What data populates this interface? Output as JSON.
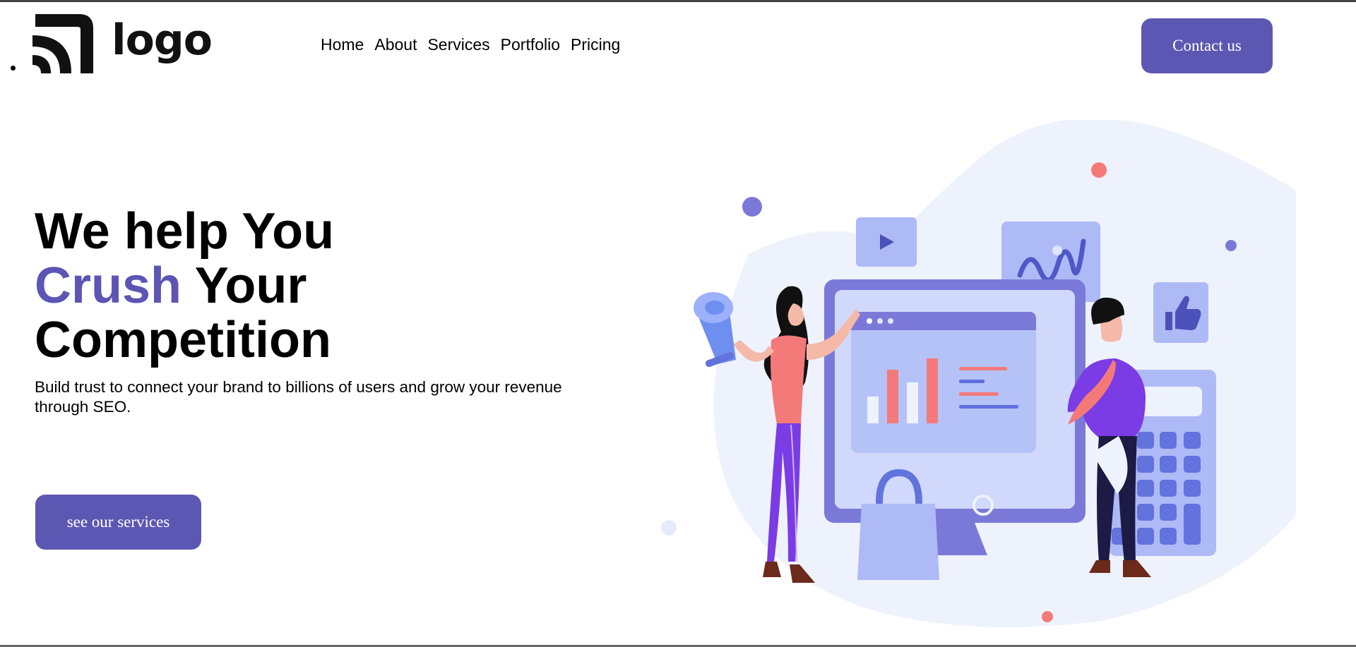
{
  "header": {
    "logo_text": "logo",
    "nav": [
      "Home",
      "About",
      "Services",
      "Portfolio",
      "Pricing"
    ],
    "contact_label": "Contact us"
  },
  "hero": {
    "title_line1": "We help You",
    "title_accent": "Crush",
    "title_line2_rest": "Your",
    "title_line3": "Competition",
    "subtitle": "Build trust to connect your brand to billions of users and grow your revenue through SEO.",
    "cta_label": "see our services"
  },
  "colors": {
    "accent": "#5c55b5",
    "button": "#5d57b4",
    "illustration_light": "#eef2fd",
    "illustration_mid": "#aebaf6",
    "illustration_dark": "#7b79d8",
    "coral": "#f47a7a"
  },
  "icons": [
    "logo-mark-icon",
    "play-icon",
    "wave-chart-icon",
    "thumbs-up-icon",
    "megaphone-icon",
    "shopping-bag-icon"
  ]
}
